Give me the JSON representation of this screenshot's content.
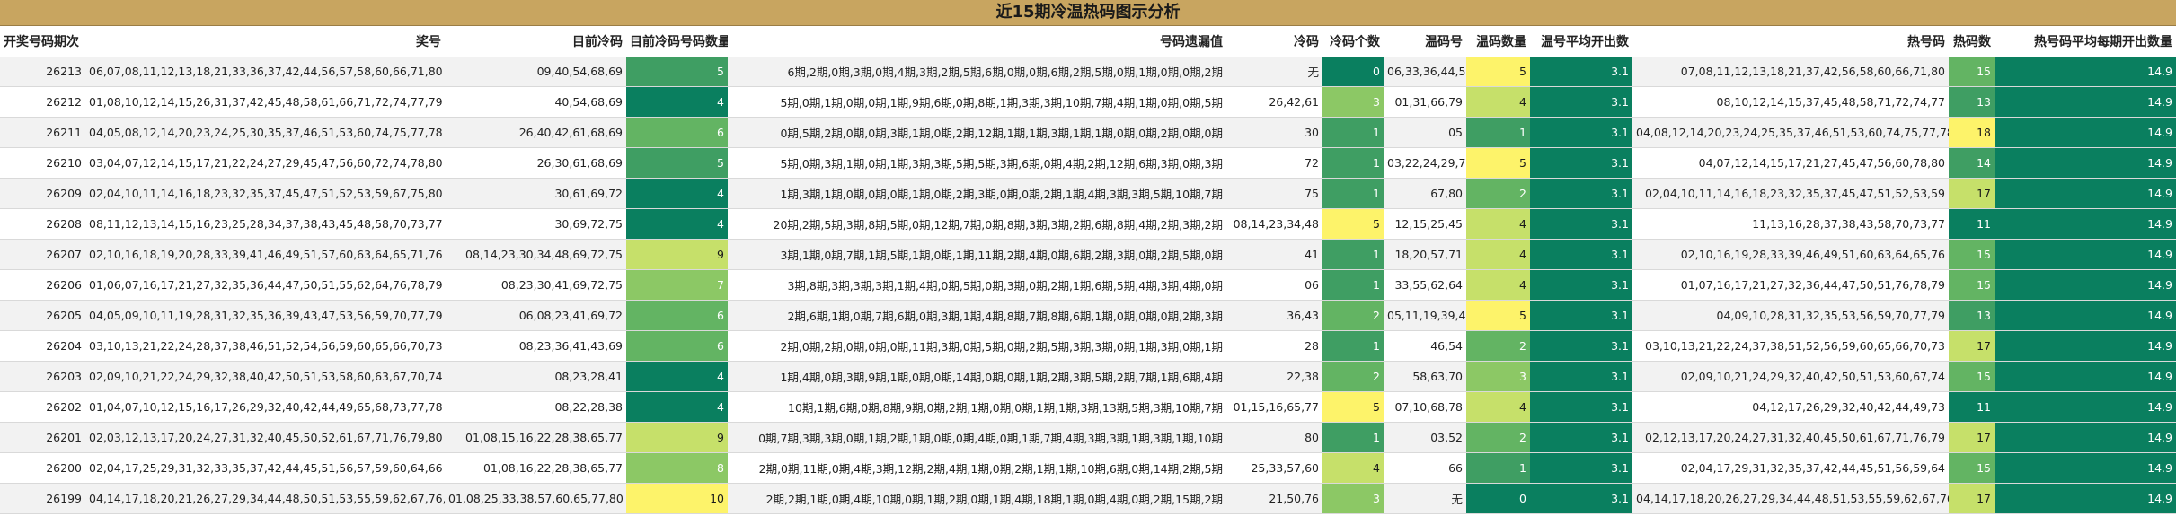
{
  "title": "近15期冷温热码图示分析",
  "columns": [
    "开奖号码期次",
    "奖号",
    "目前冷码",
    "目前冷码号码数量",
    "号码遗漏值",
    "冷码",
    "冷码个数",
    "温码号",
    "温码数量",
    "温号平均开出数",
    "热号码",
    "热码数",
    "热号码平均每期开出数量"
  ],
  "rows": [
    {
      "period": "26213",
      "numbers": "06,07,08,11,12,13,18,21,33,36,37,42,44,56,57,58,60,66,71,80",
      "cur_cold": "09,40,54,68,69",
      "cur_cold_count": 5,
      "miss": "6期,2期,0期,3期,0期,4期,3期,2期,5期,6期,0期,0期,6期,2期,5期,0期,1期,0期,0期,2期",
      "cold": "无",
      "cold_count": 0,
      "warm": "06,33,36,44,57",
      "warm_count": 5,
      "warm_avg": "3.1",
      "hot": "07,08,11,12,13,18,21,37,42,56,58,60,66,71,80",
      "hot_count": 15,
      "hot_avg": "14.9"
    },
    {
      "period": "26212",
      "numbers": "01,08,10,12,14,15,26,31,37,42,45,48,58,61,66,71,72,74,77,79",
      "cur_cold": "40,54,68,69",
      "cur_cold_count": 4,
      "miss": "5期,0期,1期,0期,0期,1期,9期,6期,0期,8期,1期,3期,3期,10期,7期,4期,1期,0期,0期,5期",
      "cold": "26,42,61",
      "cold_count": 3,
      "warm": "01,31,66,79",
      "warm_count": 4,
      "warm_avg": "3.1",
      "hot": "08,10,12,14,15,37,45,48,58,71,72,74,77",
      "hot_count": 13,
      "hot_avg": "14.9"
    },
    {
      "period": "26211",
      "numbers": "04,05,08,12,14,20,23,24,25,30,35,37,46,51,53,60,74,75,77,78",
      "cur_cold": "26,40,42,61,68,69",
      "cur_cold_count": 6,
      "miss": "0期,5期,2期,0期,0期,3期,1期,0期,2期,12期,1期,1期,3期,1期,1期,0期,0期,2期,0期,0期",
      "cold": "30",
      "cold_count": 1,
      "warm": "05",
      "warm_count": 1,
      "warm_avg": "3.1",
      "hot": "04,08,12,14,20,23,24,25,35,37,46,51,53,60,74,75,77,78",
      "hot_count": 18,
      "hot_avg": "14.9"
    },
    {
      "period": "26210",
      "numbers": "03,04,07,12,14,15,17,21,22,24,27,29,45,47,56,60,72,74,78,80",
      "cur_cold": "26,30,61,68,69",
      "cur_cold_count": 5,
      "miss": "5期,0期,3期,1期,0期,1期,3期,3期,5期,5期,3期,6期,0期,4期,2期,12期,6期,3期,0期,3期",
      "cold": "72",
      "cold_count": 1,
      "warm": "03,22,24,29,74",
      "warm_count": 5,
      "warm_avg": "3.1",
      "hot": "04,07,12,14,15,17,21,27,45,47,56,60,78,80",
      "hot_count": 14,
      "hot_avg": "14.9"
    },
    {
      "period": "26209",
      "numbers": "02,04,10,11,14,16,18,23,32,35,37,45,47,51,52,53,59,67,75,80",
      "cur_cold": "30,61,69,72",
      "cur_cold_count": 4,
      "miss": "1期,3期,1期,0期,0期,0期,1期,0期,2期,3期,0期,0期,2期,1期,4期,3期,3期,5期,10期,7期",
      "cold": "75",
      "cold_count": 1,
      "warm": "67,80",
      "warm_count": 2,
      "warm_avg": "3.1",
      "hot": "02,04,10,11,14,16,18,23,32,35,37,45,47,51,52,53,59",
      "hot_count": 17,
      "hot_avg": "14.9"
    },
    {
      "period": "26208",
      "numbers": "08,11,12,13,14,15,16,23,25,28,34,37,38,43,45,48,58,70,73,77",
      "cur_cold": "30,69,72,75",
      "cur_cold_count": 4,
      "miss": "20期,2期,5期,3期,8期,5期,0期,12期,7期,0期,8期,3期,3期,2期,6期,8期,4期,2期,3期,2期",
      "cold": "08,14,23,34,48",
      "cold_count": 5,
      "warm": "12,15,25,45",
      "warm_count": 4,
      "warm_avg": "3.1",
      "hot": "11,13,16,28,37,38,43,58,70,73,77",
      "hot_count": 11,
      "hot_avg": "14.9"
    },
    {
      "period": "26207",
      "numbers": "02,10,16,18,19,20,28,33,39,41,46,49,51,57,60,63,64,65,71,76",
      "cur_cold": "08,14,23,30,34,48,69,72,75",
      "cur_cold_count": 9,
      "miss": "3期,1期,0期,7期,1期,5期,1期,0期,1期,11期,2期,4期,0期,6期,2期,3期,0期,2期,5期,0期",
      "cold": "41",
      "cold_count": 1,
      "warm": "18,20,57,71",
      "warm_count": 4,
      "warm_avg": "3.1",
      "hot": "02,10,16,19,28,33,39,46,49,51,60,63,64,65,76",
      "hot_count": 15,
      "hot_avg": "14.9"
    },
    {
      "period": "26206",
      "numbers": "01,06,07,16,17,21,27,32,35,36,44,47,50,51,55,62,64,76,78,79",
      "cur_cold": "08,23,30,41,69,72,75",
      "cur_cold_count": 7,
      "miss": "3期,8期,3期,3期,3期,1期,4期,0期,5期,0期,3期,0期,2期,1期,6期,5期,4期,3期,4期,0期",
      "cold": "06",
      "cold_count": 1,
      "warm": "33,55,62,64",
      "warm_count": 4,
      "warm_avg": "3.1",
      "hot": "01,07,16,17,21,27,32,36,44,47,50,51,76,78,79",
      "hot_count": 15,
      "hot_avg": "14.9"
    },
    {
      "period": "26205",
      "numbers": "04,05,09,10,11,19,28,31,32,35,36,39,43,47,53,56,59,70,77,79",
      "cur_cold": "06,08,23,41,69,72",
      "cur_cold_count": 6,
      "miss": "2期,6期,1期,0期,7期,6期,0期,3期,1期,4期,8期,7期,8期,6期,1期,0期,0期,0期,2期,3期",
      "cold": "36,43",
      "cold_count": 2,
      "warm": "05,11,19,39,47",
      "warm_count": 5,
      "warm_avg": "3.1",
      "hot": "04,09,10,28,31,32,35,53,56,59,70,77,79",
      "hot_count": 13,
      "hot_avg": "14.9"
    },
    {
      "period": "26204",
      "numbers": "03,10,13,21,22,24,28,37,38,46,51,52,54,56,59,60,65,66,70,73",
      "cur_cold": "08,23,36,41,43,69",
      "cur_cold_count": 6,
      "miss": "2期,0期,2期,0期,0期,0期,11期,3期,0期,5期,0期,2期,5期,3期,3期,0期,1期,3期,0期,1期",
      "cold": "28",
      "cold_count": 1,
      "warm": "46,54",
      "warm_count": 2,
      "warm_avg": "3.1",
      "hot": "03,10,13,21,22,24,37,38,51,52,56,59,60,65,66,70,73",
      "hot_count": 17,
      "hot_avg": "14.9"
    },
    {
      "period": "26203",
      "numbers": "02,09,10,21,22,24,29,32,38,40,42,50,51,53,58,60,63,67,70,74",
      "cur_cold": "08,23,28,41",
      "cur_cold_count": 4,
      "miss": "1期,4期,0期,3期,9期,1期,0期,0期,14期,0期,0期,1期,2期,3期,5期,2期,7期,1期,6期,4期",
      "cold": "22,38",
      "cold_count": 2,
      "warm": "58,63,70",
      "warm_count": 3,
      "warm_avg": "3.1",
      "hot": "02,09,10,21,24,29,32,40,42,50,51,53,60,67,74",
      "hot_count": 15,
      "hot_avg": "14.9"
    },
    {
      "period": "26202",
      "numbers": "01,04,07,10,12,15,16,17,26,29,32,40,42,44,49,65,68,73,77,78",
      "cur_cold": "08,22,28,38",
      "cur_cold_count": 4,
      "miss": "10期,1期,6期,0期,8期,9期,0期,2期,1期,0期,0期,1期,1期,3期,13期,5期,3期,10期,7期",
      "cold": "01,15,16,65,77",
      "cold_count": 5,
      "warm": "07,10,68,78",
      "warm_count": 4,
      "warm_avg": "3.1",
      "hot": "04,12,17,26,29,32,40,42,44,49,73",
      "hot_count": 11,
      "hot_avg": "14.9"
    },
    {
      "period": "26201",
      "numbers": "02,03,12,13,17,20,24,27,31,32,40,45,50,52,61,67,71,76,79,80",
      "cur_cold": "01,08,15,16,22,28,38,65,77",
      "cur_cold_count": 9,
      "miss": "0期,7期,3期,3期,0期,1期,2期,1期,0期,0期,4期,0期,1期,7期,4期,3期,3期,1期,3期,1期,10期",
      "cold": "80",
      "cold_count": 1,
      "warm": "03,52",
      "warm_count": 2,
      "warm_avg": "3.1",
      "hot": "02,12,13,17,20,24,27,31,32,40,45,50,61,67,71,76,79",
      "hot_count": 17,
      "hot_avg": "14.9"
    },
    {
      "period": "26200",
      "numbers": "02,04,17,25,29,31,32,33,35,37,42,44,45,51,56,57,59,60,64,66",
      "cur_cold": "01,08,16,22,28,38,65,77",
      "cur_cold_count": 8,
      "miss": "2期,0期,11期,0期,4期,3期,12期,2期,4期,1期,0期,2期,1期,1期,10期,6期,0期,14期,2期,5期",
      "cold": "25,33,57,60",
      "cold_count": 4,
      "warm": "66",
      "warm_count": 1,
      "warm_avg": "3.1",
      "hot": "02,04,17,29,31,32,35,37,42,44,45,51,56,59,64",
      "hot_count": 15,
      "hot_avg": "14.9"
    },
    {
      "period": "26199",
      "numbers": "04,14,17,18,20,21,26,27,29,34,44,48,50,51,53,55,59,62,67,76,79",
      "cur_cold": "01,08,25,33,38,57,60,65,77,80",
      "cur_cold_count": 10,
      "miss": "2期,2期,1期,0期,4期,10期,0期,1期,2期,0期,1期,4期,18期,1期,0期,4期,0期,2期,15期,2期",
      "cold": "21,50,76",
      "cold_count": 3,
      "warm": "无",
      "warm_count": 0,
      "warm_avg": "3.1",
      "hot": "04,14,17,18,20,26,27,29,34,44,48,51,53,55,59,62,67,76,79",
      "hot_count": 17,
      "hot_avg": "14.9"
    }
  ],
  "heat_colors": {
    "dark_green": "#0a7f5f",
    "mid_green": "#3f9e63",
    "green": "#63b463",
    "light_green": "#8cc865",
    "yellow_green": "#c6e06a",
    "yellow": "#fdf36a"
  }
}
